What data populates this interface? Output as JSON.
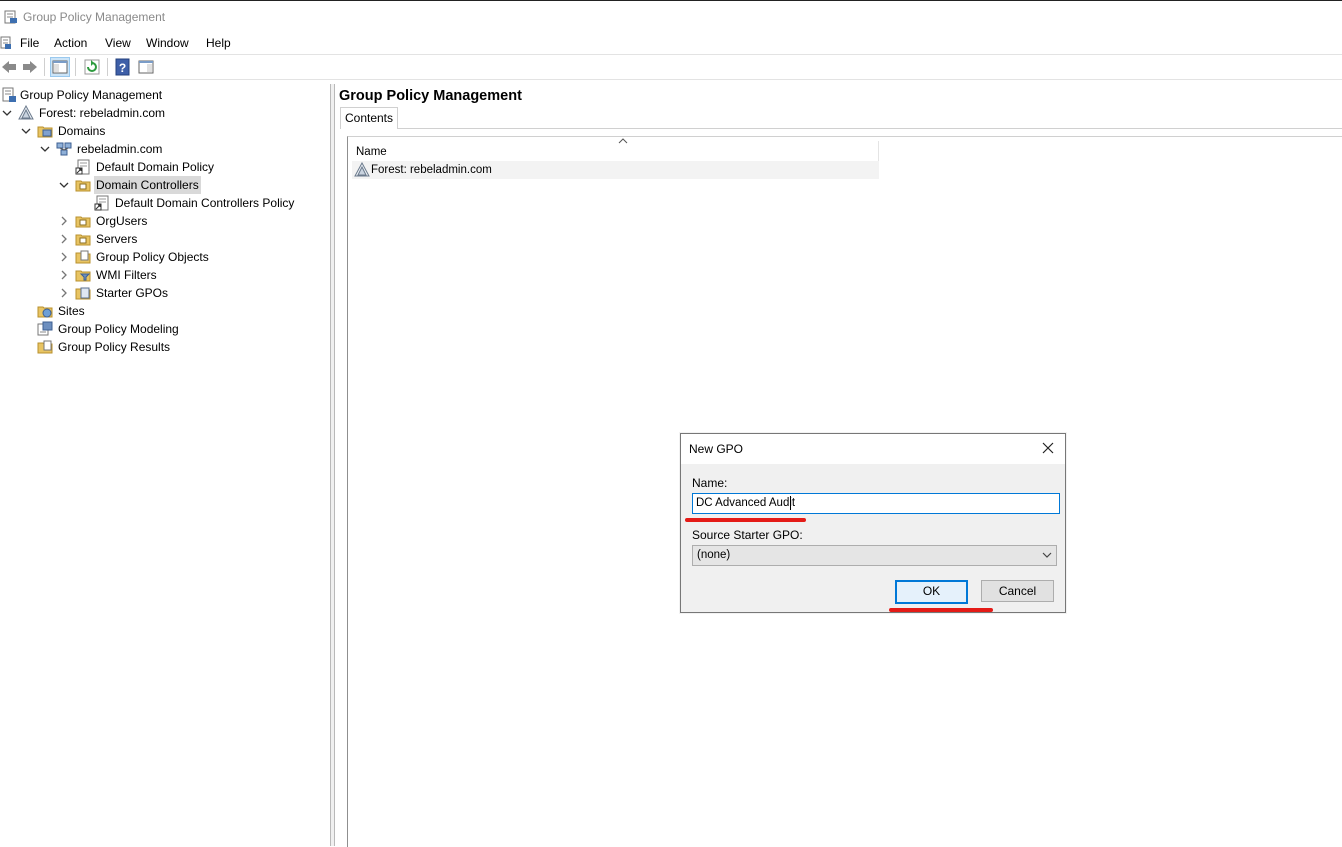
{
  "window": {
    "title": "Group Policy Management"
  },
  "menu": [
    "File",
    "Action",
    "View",
    "Window",
    "Help"
  ],
  "toolbar": {
    "buttons": [
      "back-arrow-icon",
      "forward-arrow-icon",
      "show-hide-tree-icon",
      "refresh-icon",
      "help-icon",
      "properties-pane-icon"
    ]
  },
  "tree": {
    "root": "Group Policy Management",
    "forest": "Forest: rebeladmin.com",
    "domains": "Domains",
    "domain": "rebeladmin.com",
    "default_domain_policy": "Default Domain Policy",
    "domain_controllers": "Domain Controllers",
    "default_dc_policy": "Default Domain Controllers Policy",
    "org_users": "OrgUsers",
    "servers": "Servers",
    "gpo_objects": "Group Policy Objects",
    "wmi_filters": "WMI Filters",
    "starter_gpos": "Starter GPOs",
    "sites": "Sites",
    "modeling": "Group Policy Modeling",
    "results": "Group Policy Results",
    "selected": "Domain Controllers"
  },
  "main": {
    "title": "Group Policy Management",
    "tab": "Contents",
    "column": "Name",
    "rows": [
      "Forest: rebeladmin.com"
    ]
  },
  "dialog": {
    "title": "New GPO",
    "name_label": "Name:",
    "name_value": "DC Advanced Audit",
    "starter_label": "Source Starter GPO:",
    "starter_value": "(none)",
    "ok": "OK",
    "cancel": "Cancel"
  },
  "colors": {
    "accent": "#0078d7",
    "annotation": "#e41b17",
    "selection": "#d9d9d9",
    "folder": "#e8c463"
  }
}
